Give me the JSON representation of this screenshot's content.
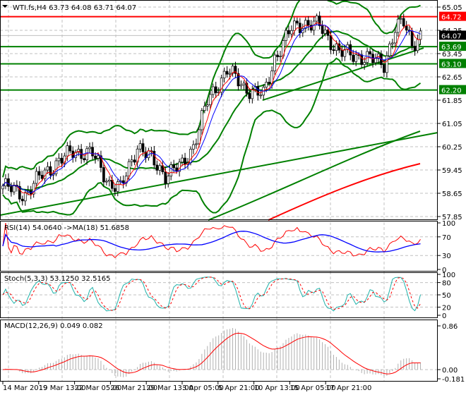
{
  "header": {
    "symbol_info": "WTI.fs,H4  63.73 64.08 63.71 64.07"
  },
  "price_axis": [
    "65.05",
    "64.25",
    "63.45",
    "62.65",
    "61.85",
    "61.05",
    "60.25",
    "59.45",
    "58.65",
    "57.85"
  ],
  "levels": [
    {
      "label": "64.72",
      "price": 64.72,
      "color": "#ff0000"
    },
    {
      "label": "63.69",
      "price": 63.69,
      "color": "#008000"
    },
    {
      "label": "63.10",
      "price": 63.1,
      "color": "#008000"
    },
    {
      "label": "62.20",
      "price": 62.2,
      "color": "#008000"
    }
  ],
  "current_price": {
    "label": "64.07",
    "price": 64.07
  },
  "rsi": {
    "label": "RSI(14) 54.0640  ->MA(18) 51.6858",
    "axis": [
      "100",
      "70",
      "30",
      "0"
    ]
  },
  "stoch": {
    "label": "Stoch(5,3,3) 53.1250 32.5165",
    "axis": [
      "100",
      "80",
      "50",
      "20",
      "0"
    ]
  },
  "macd": {
    "label": "MACD(12,26,9) 0.049 0.082",
    "axis": [
      "0.86",
      "0.00",
      "-0.181"
    ]
  },
  "time_axis": [
    "14 Mar 2019",
    "19 Mar 13:00",
    "22 Mar 05:00",
    "26 Mar 21:00",
    "29 Mar 13:00",
    "3 Apr 05:00",
    "5 Apr 21:00",
    "10 Apr 13:00",
    "15 Apr 05:00",
    "17 Apr 21:00"
  ],
  "chart_data": {
    "type": "candlestick",
    "title": "WTI.fs,H4",
    "ylim": [
      57.85,
      65.05
    ],
    "close_keypoints": [
      [
        0,
        58.9
      ],
      [
        8,
        58.6
      ],
      [
        14,
        59.3
      ],
      [
        25,
        60.1
      ],
      [
        32,
        60.0
      ],
      [
        38,
        59.0
      ],
      [
        42,
        58.8
      ],
      [
        48,
        60.3
      ],
      [
        58,
        59.3
      ],
      [
        64,
        59.6
      ],
      [
        68,
        60.3
      ],
      [
        73,
        61.8
      ],
      [
        80,
        62.9
      ],
      [
        86,
        62.3
      ],
      [
        93,
        62.0
      ],
      [
        97,
        63.3
      ],
      [
        103,
        64.3
      ],
      [
        107,
        64.5
      ],
      [
        113,
        64.4
      ],
      [
        120,
        63.5
      ],
      [
        130,
        63.3
      ],
      [
        136,
        63.1
      ],
      [
        140,
        64.3
      ],
      [
        143,
        64.5
      ],
      [
        146,
        63.8
      ],
      [
        149,
        64.07
      ]
    ],
    "colors": {
      "bollinger": "#008000",
      "ma_fast": "#ff0000",
      "ma_slow": "#0000ff",
      "rsi": "#ff0000",
      "rsi_ma": "#0000ff",
      "stoch_main": "#20b2aa",
      "stoch_signal": "#ff0000",
      "macd": "#ff0000"
    }
  }
}
